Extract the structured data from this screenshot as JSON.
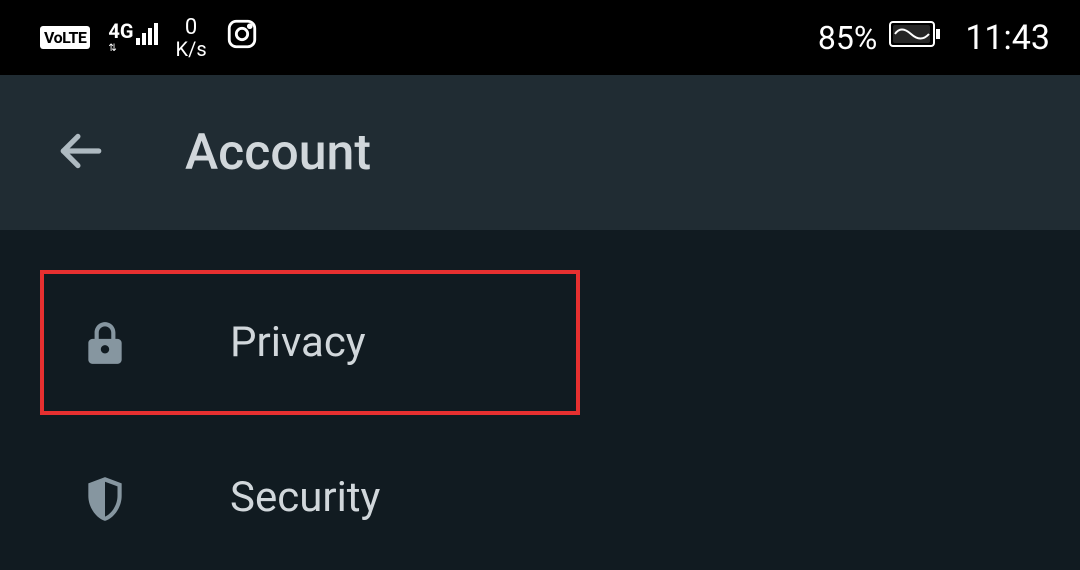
{
  "status_bar": {
    "volte": "VoLTE",
    "network": "4G",
    "speed_value": "0",
    "speed_unit": "K/s",
    "battery_pct": "85%",
    "clock": "11:43"
  },
  "app_bar": {
    "title": "Account"
  },
  "menu": {
    "items": [
      {
        "label": "Privacy",
        "icon": "lock-icon",
        "highlighted": true
      },
      {
        "label": "Security",
        "icon": "shield-icon",
        "highlighted": false
      }
    ]
  }
}
